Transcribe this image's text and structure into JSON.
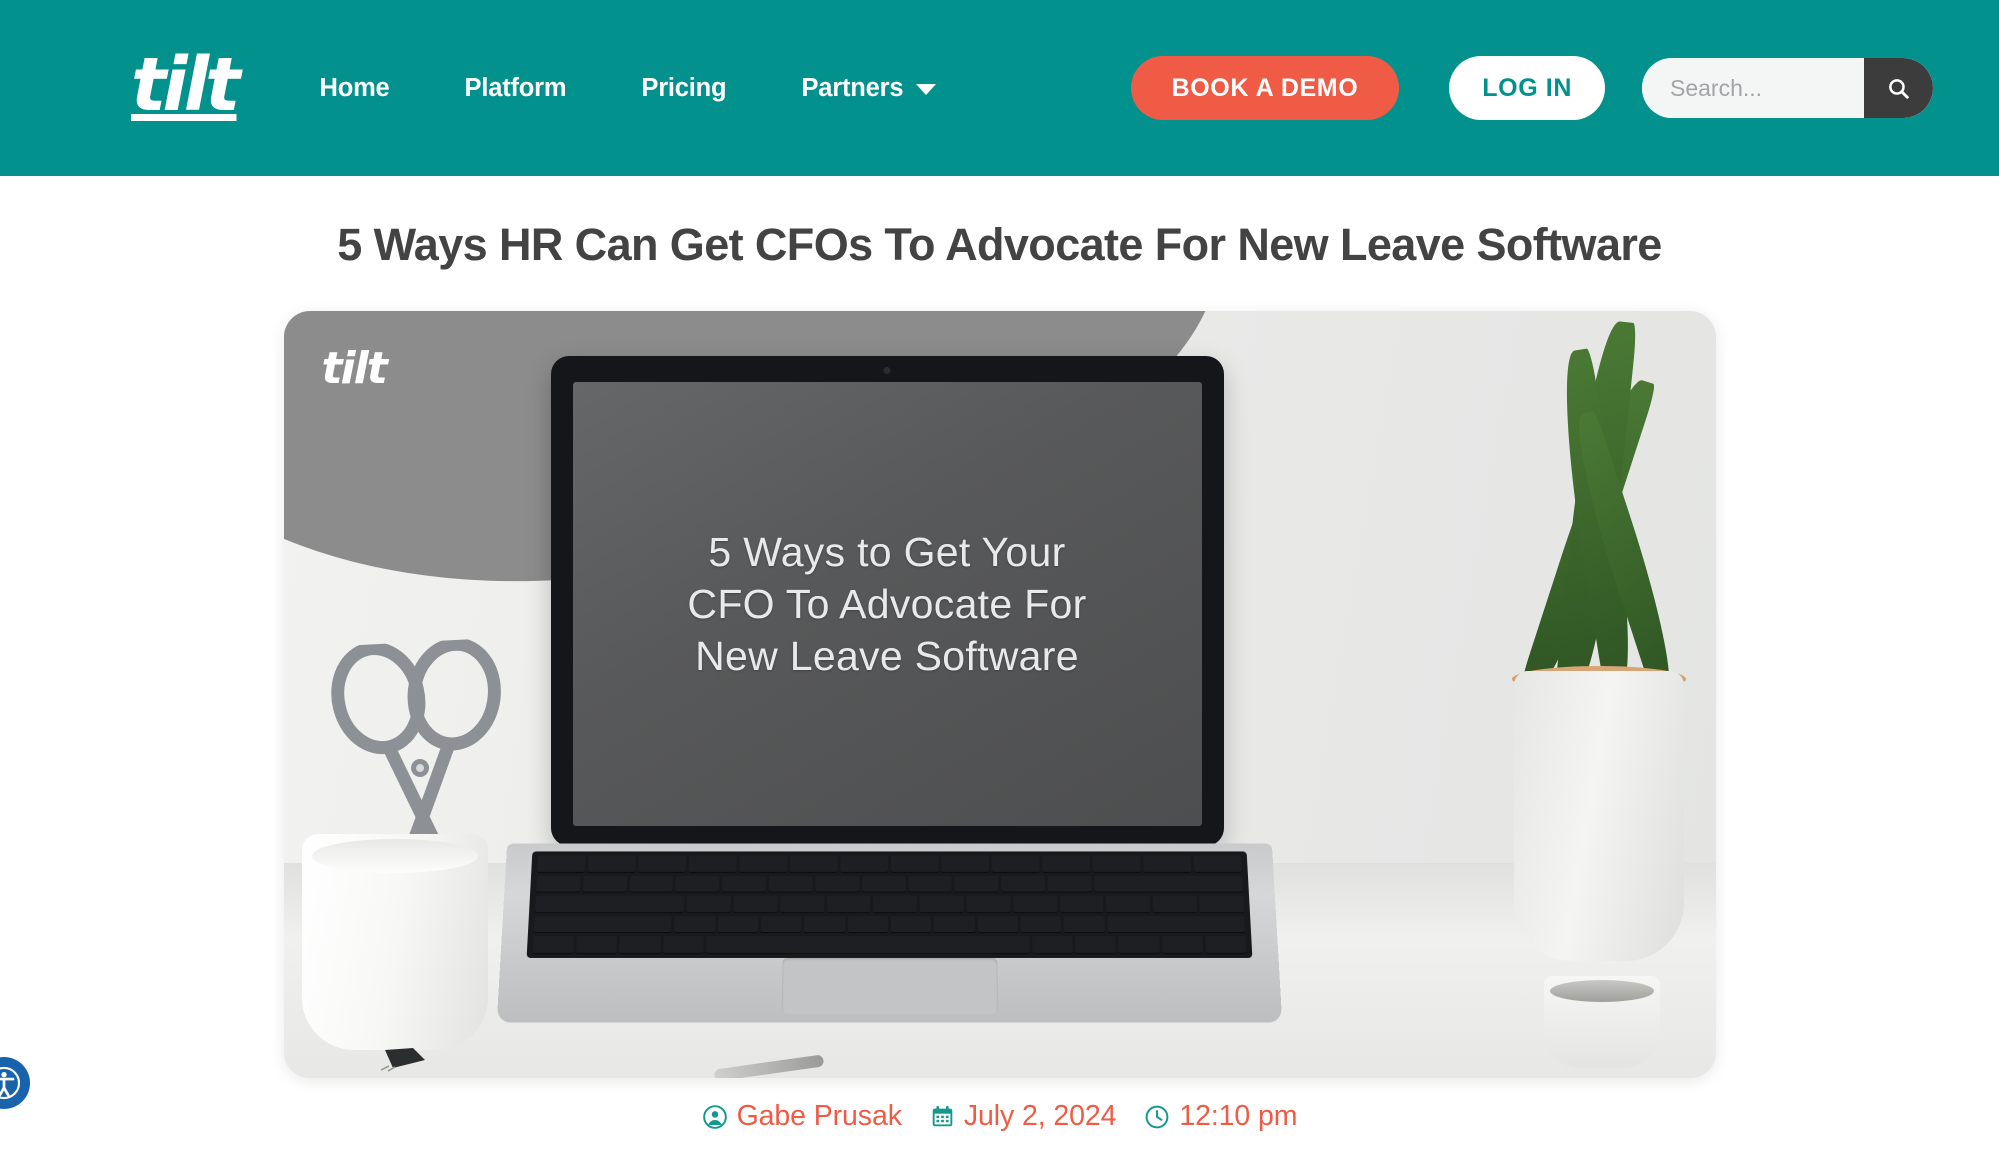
{
  "header": {
    "logo_text": "tilt",
    "nav": [
      {
        "label": "Home",
        "has_dropdown": false
      },
      {
        "label": "Platform",
        "has_dropdown": false
      },
      {
        "label": "Pricing",
        "has_dropdown": false
      },
      {
        "label": "Partners",
        "has_dropdown": true
      }
    ],
    "demo_button": "BOOK A DEMO",
    "login_button": "LOG IN",
    "search": {
      "placeholder": "Search...",
      "value": "",
      "icon": "search-icon"
    },
    "colors": {
      "background": "#03918e",
      "demo_button": "#ef5b45",
      "login_text": "#03918e",
      "search_button": "#3c3c3c"
    }
  },
  "article": {
    "title": "5 Ways HR Can Get CFOs To Advocate For New Leave Software",
    "featured_image": {
      "overlay_logo": "tilt",
      "laptop_screen_text": "5 Ways to Get Your\nCFO To Advocate For\nNew Leave Software",
      "alt": "Laptop on white desk with scissors in a mug and a potted plant"
    },
    "meta": [
      {
        "icon": "user-circle-icon",
        "text": "Gabe Prusak"
      },
      {
        "icon": "calendar-icon",
        "text": "July 2, 2024"
      },
      {
        "icon": "clock-icon",
        "text": "12:10 pm"
      }
    ],
    "meta_colors": {
      "icon": "#12988f",
      "text": "#ef5b45"
    },
    "title_color": "#434343"
  },
  "accessibility_widget": {
    "icon": "accessibility-icon",
    "color": "#1963ad"
  }
}
